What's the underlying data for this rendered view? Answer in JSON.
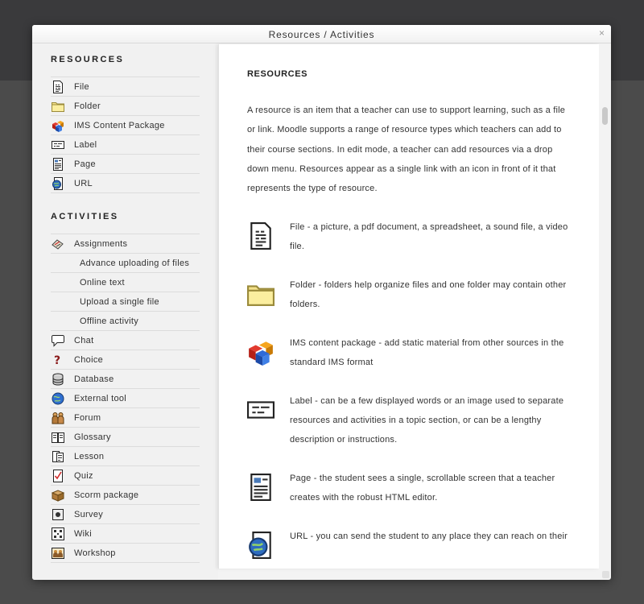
{
  "dialog": {
    "title": "Resources / Activities",
    "close_label": "×"
  },
  "sidebar": {
    "resources_heading": "RESOURCES",
    "resources": [
      {
        "label": "File",
        "icon": "file-icon"
      },
      {
        "label": "Folder",
        "icon": "folder-icon"
      },
      {
        "label": "IMS Content Package",
        "icon": "ims-package-icon"
      },
      {
        "label": "Label",
        "icon": "label-icon"
      },
      {
        "label": "Page",
        "icon": "page-icon"
      },
      {
        "label": "URL",
        "icon": "url-icon"
      }
    ],
    "activities_heading": "ACTIVITIES",
    "activities": [
      {
        "label": "Assignments",
        "icon": "assignment-icon"
      },
      {
        "label": "Advance uploading of files",
        "sub": true
      },
      {
        "label": "Online text",
        "sub": true
      },
      {
        "label": "Upload a single file",
        "sub": true
      },
      {
        "label": "Offline activity",
        "sub": true
      },
      {
        "label": "Chat",
        "icon": "chat-icon"
      },
      {
        "label": "Choice",
        "icon": "choice-icon"
      },
      {
        "label": "Database",
        "icon": "database-icon"
      },
      {
        "label": "External tool",
        "icon": "external-tool-icon"
      },
      {
        "label": "Forum",
        "icon": "forum-icon"
      },
      {
        "label": "Glossary",
        "icon": "glossary-icon"
      },
      {
        "label": "Lesson",
        "icon": "lesson-icon"
      },
      {
        "label": "Quiz",
        "icon": "quiz-icon"
      },
      {
        "label": "Scorm package",
        "icon": "scorm-icon"
      },
      {
        "label": "Survey",
        "icon": "survey-icon"
      },
      {
        "label": "Wiki",
        "icon": "wiki-icon"
      },
      {
        "label": "Workshop",
        "icon": "workshop-icon"
      }
    ]
  },
  "content": {
    "heading": "RESOURCES",
    "intro": "A resource is an item that a teacher can use to support learning, such as a file or link. Moodle supports a range of resource types which teachers can add to their course sections. In edit mode, a teacher can add resources via a drop down menu. Resources appear as a single link with an icon in front of it that represents the type of resource.",
    "items": [
      {
        "text": "File - a picture, a pdf document, a spreadsheet, a sound file, a video file.",
        "icon": "file-icon"
      },
      {
        "text": "Folder - folders help organize files and one folder may contain other folders.",
        "icon": "folder-icon"
      },
      {
        "text": "IMS content package - add static material from other sources in the standard IMS format",
        "icon": "ims-package-icon"
      },
      {
        "text": "Label - can be a few displayed words or an image used to separate resources and activities in a topic section, or can be a lengthy description or instructions.",
        "icon": "label-icon"
      },
      {
        "text": "Page - the student sees a single, scrollable screen that a teacher creates with the robust HTML editor.",
        "icon": "page-icon"
      },
      {
        "text": "URL - you can send the student to any place they can reach on their",
        "icon": "url-icon"
      }
    ]
  }
}
